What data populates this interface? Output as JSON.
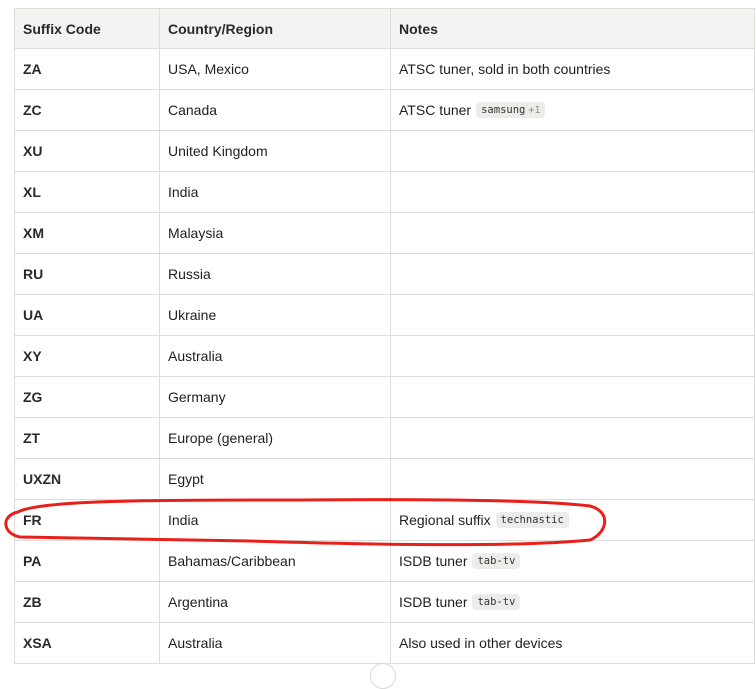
{
  "table": {
    "headers": [
      "Suffix Code",
      "Country/Region",
      "Notes"
    ],
    "rows": [
      {
        "code": "ZA",
        "country": "USA, Mexico",
        "notes": "ATSC tuner, sold in both countries",
        "source": "",
        "extra": ""
      },
      {
        "code": "ZC",
        "country": "Canada",
        "notes": "ATSC tuner",
        "source": "samsung",
        "extra": "+1"
      },
      {
        "code": "XU",
        "country": "United Kingdom",
        "notes": "",
        "source": "",
        "extra": ""
      },
      {
        "code": "XL",
        "country": "India",
        "notes": "",
        "source": "",
        "extra": ""
      },
      {
        "code": "XM",
        "country": "Malaysia",
        "notes": "",
        "source": "",
        "extra": ""
      },
      {
        "code": "RU",
        "country": "Russia",
        "notes": "",
        "source": "",
        "extra": ""
      },
      {
        "code": "UA",
        "country": "Ukraine",
        "notes": "",
        "source": "",
        "extra": ""
      },
      {
        "code": "XY",
        "country": "Australia",
        "notes": "",
        "source": "",
        "extra": ""
      },
      {
        "code": "ZG",
        "country": "Germany",
        "notes": "",
        "source": "",
        "extra": ""
      },
      {
        "code": "ZT",
        "country": "Europe (general)",
        "notes": "",
        "source": "",
        "extra": ""
      },
      {
        "code": "UXZN",
        "country": "Egypt",
        "notes": "",
        "source": "",
        "extra": ""
      },
      {
        "code": "FR",
        "country": "India",
        "notes": "Regional suffix",
        "source": "technastic",
        "extra": ""
      },
      {
        "code": "PA",
        "country": "Bahamas/Caribbean",
        "notes": "ISDB tuner",
        "source": "tab-tv",
        "extra": ""
      },
      {
        "code": "ZB",
        "country": "Argentina",
        "notes": "ISDB tuner",
        "source": "tab-tv",
        "extra": ""
      },
      {
        "code": "XSA",
        "country": "Australia",
        "notes": "Also used in other devices",
        "source": "",
        "extra": ""
      }
    ]
  },
  "highlight": {
    "row_code": "FR",
    "color": "#e8201c"
  },
  "colors": {
    "header_bg": "#f3f3f1",
    "border": "#dcdcd8",
    "tag_bg": "#ececea"
  }
}
